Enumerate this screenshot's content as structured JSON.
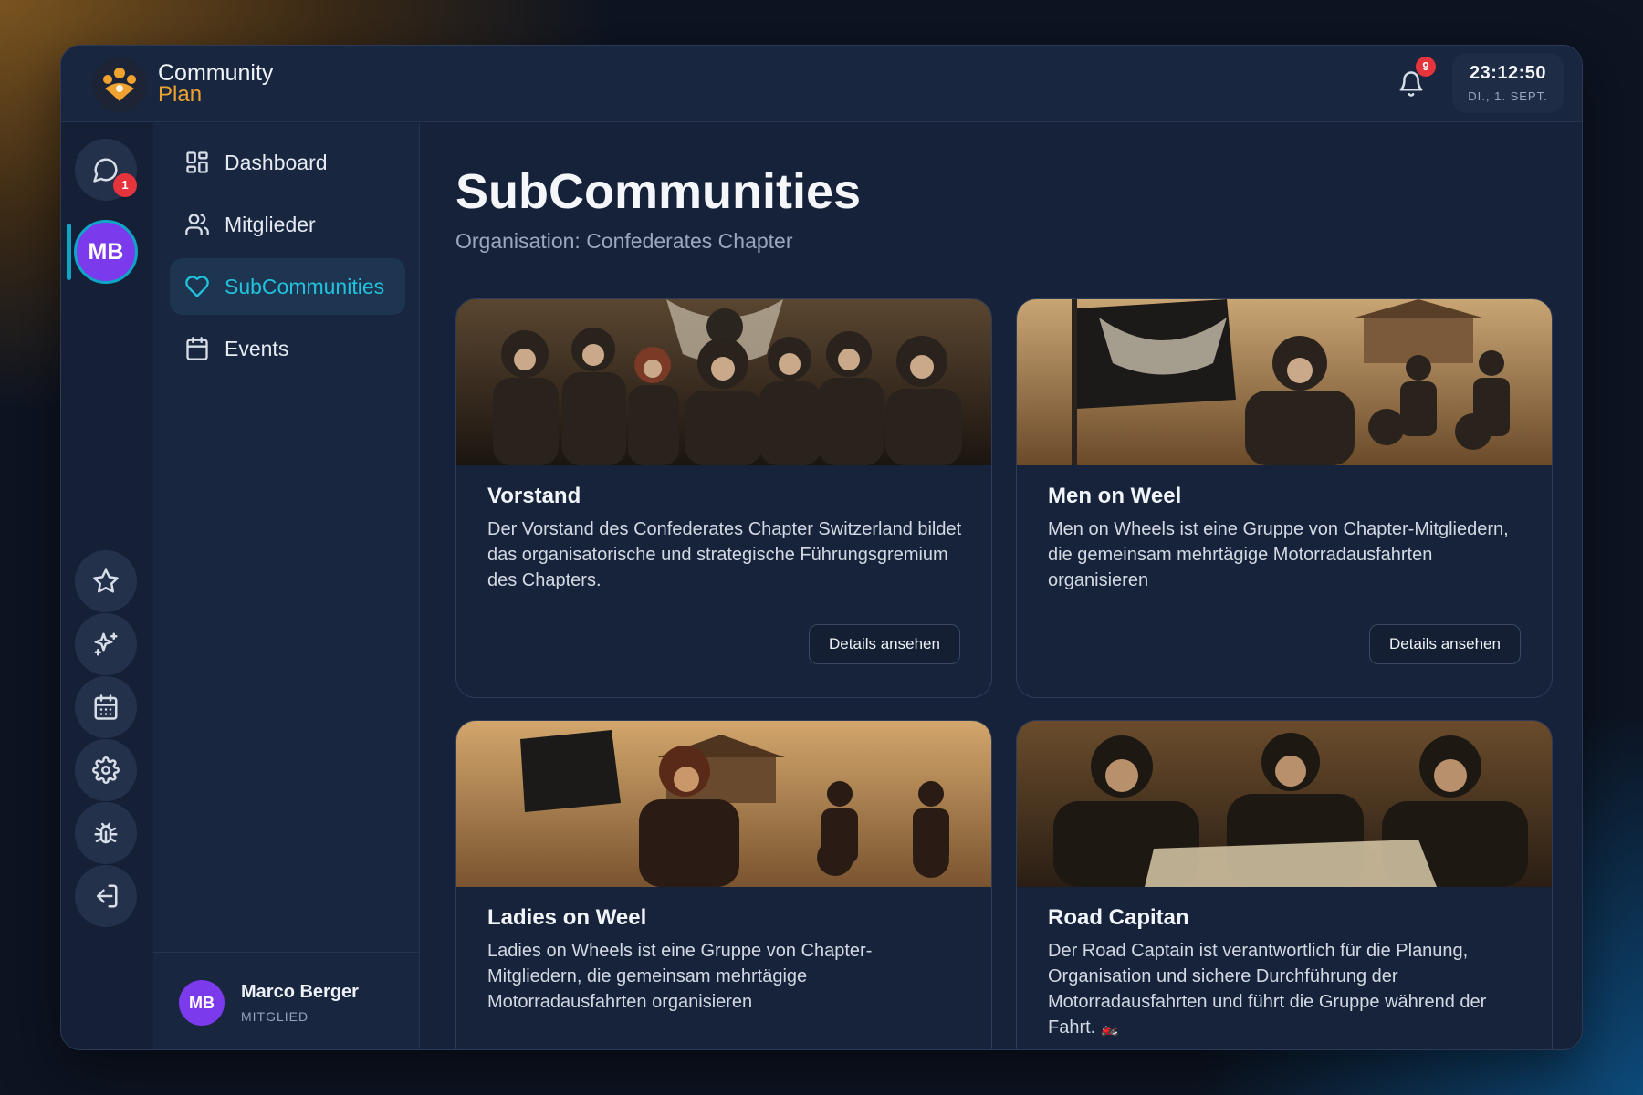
{
  "app": {
    "brand_line1": "Community",
    "brand_line2": "Plan"
  },
  "header": {
    "notification_count": "9",
    "time": "23:12:50",
    "date": "DI., 1. SEPT."
  },
  "rail": {
    "chat_badge": "1",
    "avatar_initials": "MB",
    "icons": [
      "chat-icon",
      "star-icon",
      "sparkles-icon",
      "calendar-icon",
      "settings-icon",
      "bug-icon",
      "logout-icon"
    ]
  },
  "nav": {
    "items": [
      {
        "label": "Dashboard",
        "icon": "dashboard-icon"
      },
      {
        "label": "Mitglieder",
        "icon": "members-icon"
      },
      {
        "label": "SubCommunities",
        "icon": "heart-icon",
        "active": true
      },
      {
        "label": "Events",
        "icon": "calendar-icon"
      }
    ]
  },
  "user": {
    "initials": "MB",
    "name": "Marco Berger",
    "role": "MITGLIED"
  },
  "page": {
    "title": "SubCommunities",
    "subtitle": "Organisation: Confederates Chapter"
  },
  "cards": [
    {
      "title": "Vorstand",
      "description": "Der Vorstand des Confederates Chapter Switzerland bildet das organisatorische und strategische Führungsgremium des Chapters.",
      "button": "Details ansehen"
    },
    {
      "title": "Men on Weel",
      "description": "Men on Wheels ist eine Gruppe von Chapter-Mitgliedern, die gemeinsam mehrtägige Motorradausfahrten organisieren",
      "button": "Details ansehen"
    },
    {
      "title": "Ladies on Weel",
      "description": "Ladies on Wheels ist eine Gruppe von Chapter-Mitgliedern, die gemeinsam mehrtägige Motorradausfahrten organisieren"
    },
    {
      "title": "Road Capitan",
      "description": "Der Road Captain ist verantwortlich für die Planung, Organisation und sichere Durchführung der Motorradausfahrten und führt die Gruppe während der Fahrt.",
      "emoji": "🏍️"
    }
  ],
  "colors": {
    "accent": "#22c1dc",
    "brand_orange": "#f0a230",
    "badge_red": "#e5343b",
    "avatar_purple": "#7c3aed"
  }
}
